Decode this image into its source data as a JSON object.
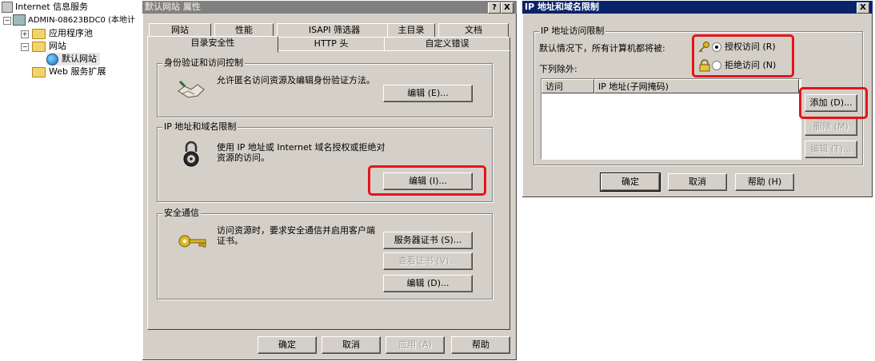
{
  "tree": {
    "root": "Internet 信息服务",
    "server": "ADMIN-08623BDC0 (本地计",
    "app_pools": "应用程序池",
    "websites": "网站",
    "default_site": "默认网站",
    "web_ext": "Web 服务扩展"
  },
  "props": {
    "title": "默认网站 属性",
    "help_btn": "?",
    "close_btn": "X",
    "tabs_row1": [
      "网站",
      "性能",
      "ISAPI 筛选器",
      "主目录",
      "文档"
    ],
    "tabs_row2": [
      "目录安全性",
      "HTTP 头",
      "自定义错误"
    ],
    "auth_group": "身份验证和访问控制",
    "auth_desc": "允许匿名访问资源及编辑身份验证方法。",
    "auth_edit": "编辑 (E)...",
    "ip_group": "IP 地址和域名限制",
    "ip_desc": "使用 IP 地址或 Internet 域名授权或拒绝对资源的访问。",
    "ip_edit": "编辑 (I)...",
    "secure_group": "安全通信",
    "secure_desc": "访问资源时，要求安全通信并启用客户端证书。",
    "server_cert": "服务器证书 (S)...",
    "view_cert": "查看证书 (V)...",
    "secure_edit": "编辑 (D)...",
    "ok": "确定",
    "cancel": "取消",
    "apply": "应用 (A)",
    "help": "帮助"
  },
  "ipdlg": {
    "title": "IP 地址和域名限制",
    "close_btn": "X",
    "group": "IP 地址访问限制",
    "default_label": "默认情况下，所有计算机都将被:",
    "grant": "授权访问 (R)",
    "deny": "拒绝访问 (N)",
    "except_label": "下列除外:",
    "col_access": "访问",
    "col_ip": "IP 地址(子网掩码)",
    "add": "添加 (D)...",
    "remove": "删除 (M)",
    "edit": "编辑 (T)...",
    "ok": "确定",
    "cancel": "取消",
    "help": "帮助 (H)",
    "grant_selected": true
  },
  "colors": {
    "titlebar_inactive": "#808080",
    "titlebar_active": "#0a246a",
    "highlight": "#e8121a",
    "face": "#d4d0c8"
  }
}
